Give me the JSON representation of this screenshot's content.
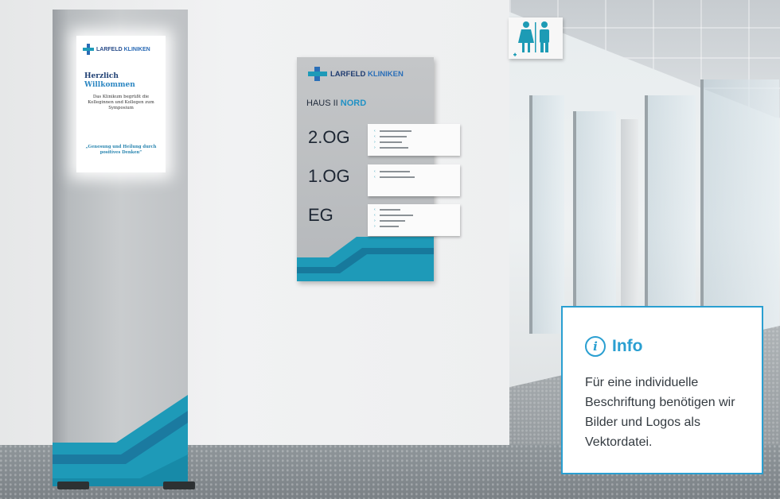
{
  "totem": {
    "brand_prefix": "LARFELD",
    "brand_suffix": "KLINIKEN",
    "heading_line1": "Herzlich",
    "heading_line2": "Willkommen",
    "body": "Das Klinikum begrüßt die Kolleginnen und Kollegen zum Symposium",
    "quote": "„Genesung und Heilung durch positives Denken“"
  },
  "wall_sign": {
    "brand_prefix": "LARFELD",
    "brand_suffix": "KLINIKEN",
    "building_prefix": "HAUS II",
    "building_suffix": "NORD",
    "floors": [
      "2.OG",
      "1.OG",
      "EG"
    ]
  },
  "info": {
    "title": "Info",
    "text": "Für eine individuelle Beschriftung benötigen wir Bilder und Logos als Vektordatei."
  },
  "colors": {
    "accent": "#2a9fd1",
    "teal": "#1d9bb5",
    "navy": "#1f3c70"
  }
}
